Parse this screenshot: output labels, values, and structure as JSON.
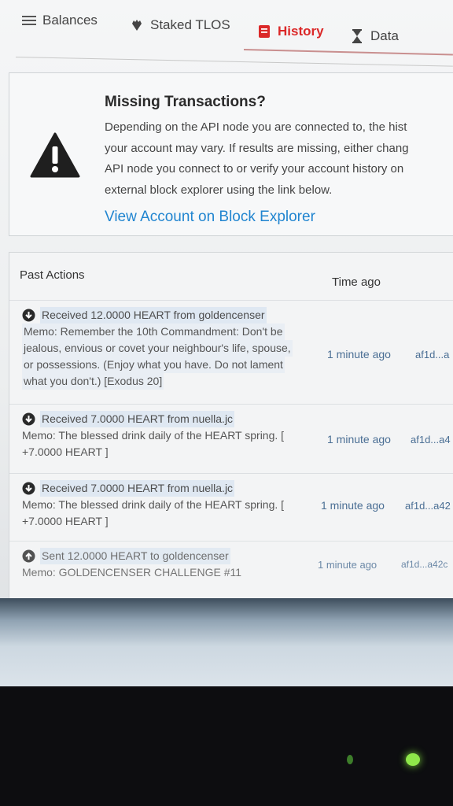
{
  "tabs": [
    {
      "label": "Balances",
      "icon": "hamburger-icon"
    },
    {
      "label": "Staked TLOS",
      "icon": "stake-icon"
    },
    {
      "label": "History",
      "icon": "history-icon",
      "active": true
    },
    {
      "label": "Data",
      "icon": "hourglass-icon"
    }
  ],
  "colors": {
    "active_tab": "#db2828",
    "link": "#2185d0"
  },
  "missing": {
    "title": "Missing Transactions?",
    "body_lines": [
      "Depending on the API node you are connected to, the hist",
      "your account may vary. If results are missing, either chang",
      "API node you connect to or verify your account history on",
      "external block explorer using the link below."
    ],
    "link": "View Account on Block Explorer"
  },
  "actions": {
    "col_past": "Past Actions",
    "col_time": "Time ago",
    "rows": [
      {
        "dir": "received",
        "summary": "Received 12.0000 HEART from goldencenser",
        "memo_lines": [
          "Memo: Remember the 10th Commandment: Don't be",
          "jealous, envious or covet your neighbour's life, spouse,",
          "or possessions. (Enjoy what you have. Do not lament",
          "what you don't.) [Exodus 20]"
        ],
        "time": "1 minute ago",
        "tx": "af1d...a"
      },
      {
        "dir": "received",
        "summary": "Received 7.0000 HEART from nuella.jc",
        "memo_lines": [
          "Memo: The blessed drink daily of the HEART spring. [",
          "+7.0000 HEART ]"
        ],
        "time": "1 minute ago",
        "tx": "af1d...a4"
      },
      {
        "dir": "received",
        "summary": "Received 7.0000 HEART from nuella.jc",
        "memo_lines": [
          "Memo: The blessed drink daily of the HEART spring. [",
          "+7.0000 HEART ]"
        ],
        "time": "1 minute ago",
        "tx": "af1d...a42"
      },
      {
        "dir": "sent",
        "summary": "Sent 12.0000 HEART to goldencenser",
        "memo_lines": [
          "Memo: GOLDENCENSER CHALLENGE #11"
        ],
        "time": "1 minute ago",
        "tx": "af1d...a42c"
      }
    ]
  }
}
